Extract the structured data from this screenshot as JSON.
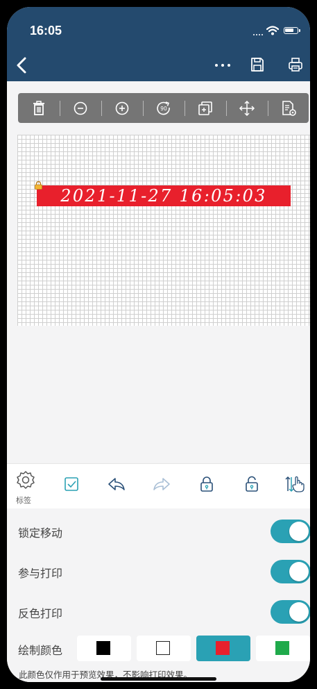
{
  "status": {
    "time": "16:05"
  },
  "header": {
    "back_icon": "chevron-left-icon",
    "more_icon": "ellipsis-icon",
    "save_icon": "save-icon",
    "print_icon": "printer-icon"
  },
  "toolbar": {
    "items": [
      "delete-icon",
      "zoom-out-icon",
      "zoom-in-icon",
      "rotate-90-icon",
      "duplicate-icon",
      "move-icon",
      "properties-icon"
    ],
    "rotate_label": "90"
  },
  "canvas": {
    "label_text": "2021-11-27 16:05:03",
    "label_bg": "#e8202c"
  },
  "bottombar": {
    "settings_label": "标签",
    "items": [
      "settings-icon",
      "checkbox-icon",
      "undo-icon",
      "redo-icon",
      "lock-icon",
      "unlock-icon",
      "layer-order-icon"
    ]
  },
  "settings": {
    "lock_move": "锁定移动",
    "participate_print": "参与打印",
    "invert_print": "反色打印",
    "draw_color": "绘制颜色",
    "note": "此颜色仅作用于预览效果，不影响打印效果。"
  },
  "colors": {
    "accent": "#2aa1b4",
    "header": "#244a6e",
    "swatches": [
      "#000000",
      "#ffffff",
      "#e8202c",
      "#1faa4b"
    ],
    "selected_swatch": 2
  }
}
